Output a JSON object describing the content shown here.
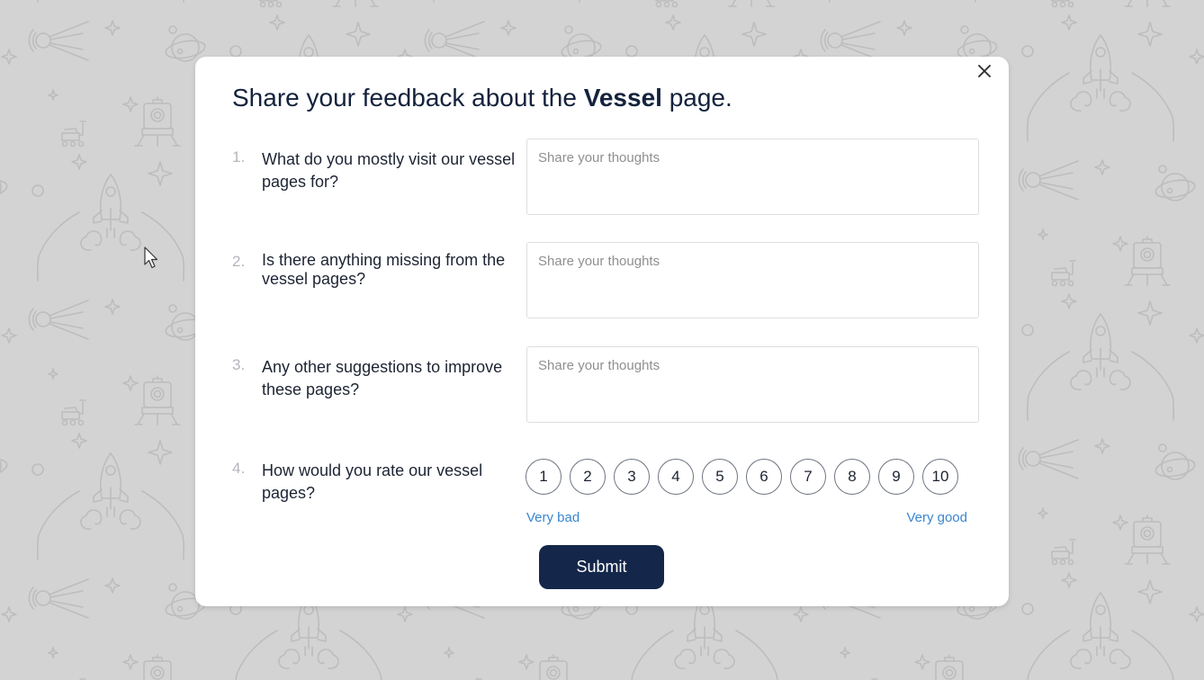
{
  "colors": {
    "page_background": "#d3d3d3",
    "pattern_stroke": "#bdbdbd",
    "title_text": "#14223c",
    "accent_link": "#3a86d0",
    "submit_background": "#14274a",
    "submit_text": "#ffffff"
  },
  "background": {
    "pattern_icons": [
      "rocket-icon",
      "satellite-icon",
      "planet-icon",
      "rover-icon",
      "lander-icon",
      "sparkle-icon",
      "circle-icon"
    ]
  },
  "modal": {
    "close_icon": "close-icon",
    "title": {
      "prefix": "Share your feedback about the ",
      "bold": "Vessel",
      "suffix": " page."
    },
    "questions": [
      {
        "number": "1.",
        "text": "What do you mostly visit our vessel pages for?",
        "type": "text",
        "placeholder": "Share your thoughts",
        "value": ""
      },
      {
        "number": "2.",
        "text": "Is there anything missing from the vessel pages?",
        "type": "text",
        "placeholder": "Share your thoughts",
        "value": ""
      },
      {
        "number": "3.",
        "text": "Any other suggestions to improve these pages?",
        "type": "text",
        "placeholder": "Share your thoughts",
        "value": ""
      },
      {
        "number": "4.",
        "text": "How would you rate our vessel pages?",
        "type": "rating"
      }
    ],
    "rating": {
      "options": [
        "1",
        "2",
        "3",
        "4",
        "5",
        "6",
        "7",
        "8",
        "9",
        "10"
      ],
      "selected": null,
      "low_label": "Very bad",
      "high_label": "Very good"
    },
    "submit_label": "Submit"
  },
  "cursor": {
    "icon": "mouse-pointer-icon"
  }
}
